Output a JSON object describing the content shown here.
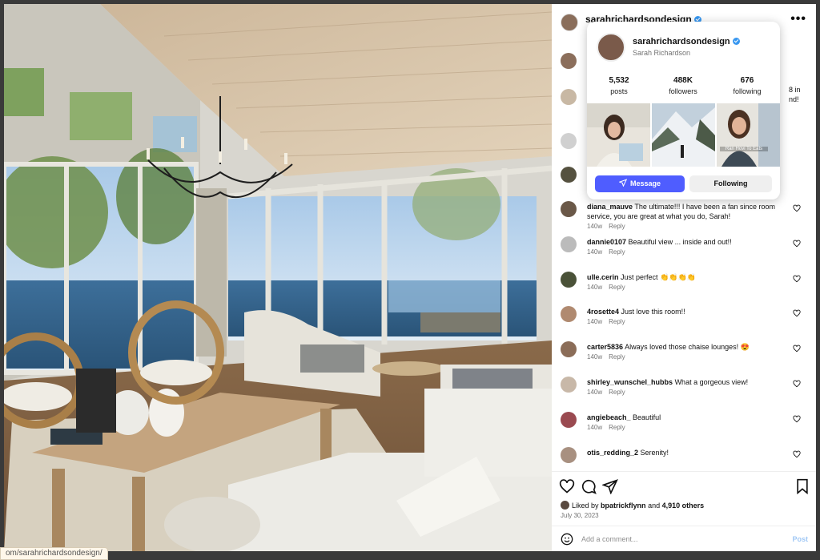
{
  "post": {
    "username": "sarahrichardsondesign",
    "more_icon": "more-horizontal-icon"
  },
  "card": {
    "username": "sarahrichardsondesign",
    "full_name": "Sarah Richardson",
    "posts_count": "5,532",
    "posts_label": "posts",
    "followers_count": "488K",
    "followers_label": "followers",
    "following_count": "676",
    "following_label": "following",
    "thumb_caption": "Ran Hovi To Eats",
    "message_label": "Message",
    "following_label_btn": "Following"
  },
  "partial": {
    "line1": "8 in",
    "line2": "nd!"
  },
  "comments": [
    {
      "user": "diana_mauve",
      "text": "The ultimate!!! I have been a fan since room service, you are great at what you do, Sarah!",
      "time": "140w",
      "reply": "Reply",
      "avatar": "#6a5848"
    },
    {
      "user": "dannie0107",
      "text": "Beautiful view ... inside and out!!",
      "time": "140w",
      "reply": "Reply",
      "avatar": "#bbbbbb"
    },
    {
      "user": "ulle.cerin",
      "text": "Just perfect 👏👏👏👏",
      "time": "140w",
      "reply": "Reply",
      "avatar": "#4a5238"
    },
    {
      "user": "4rosette4",
      "text": "Just love this room!!",
      "time": "140w",
      "reply": "Reply",
      "avatar": "#b08a70"
    },
    {
      "user": "carter5836",
      "text": "Always loved those chaise lounges! 😍",
      "time": "140w",
      "reply": "Reply",
      "avatar": "#8b6d58"
    },
    {
      "user": "shirley_wunschel_hubbs",
      "text": "What a gorgeous view!",
      "time": "140w",
      "reply": "Reply",
      "avatar": "#c8b8a8"
    },
    {
      "user": "angiebeach_",
      "text": "Beautiful",
      "time": "140w",
      "reply": "Reply",
      "avatar": "#9a4a50"
    },
    {
      "user": "otis_redding_2",
      "text": "Serenity!",
      "time": "",
      "reply": "",
      "avatar": "#a89080"
    }
  ],
  "likes": {
    "prefix": "Liked by",
    "user": "bpatrickflynn",
    "mid": "and",
    "others": "4,910 others"
  },
  "date": "July 30, 2023",
  "add_comment": {
    "placeholder": "Add a comment...",
    "post_label": "Post"
  },
  "status_url": "om/sarahrichardsondesign/",
  "colors": {
    "accent": "#4f5dff",
    "verified": "#3897f0",
    "meta": "#737373"
  }
}
